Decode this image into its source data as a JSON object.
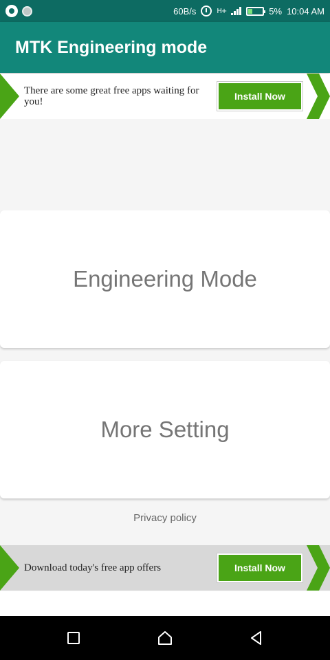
{
  "status_bar": {
    "speed": "60B/s",
    "data_label": "H+",
    "battery": "5%",
    "time": "10:04 AM",
    "icons": [
      "whatsapp-icon",
      "notification-dot-icon",
      "alarm-icon",
      "mobile-data-icon",
      "signal-icon",
      "battery-charging-icon"
    ]
  },
  "app_bar": {
    "title": "MTK Engineering mode"
  },
  "ad_top": {
    "text": "There are some great free apps waiting for you!",
    "button": "Install Now"
  },
  "cards": [
    {
      "label": "Engineering Mode"
    },
    {
      "label": "More Setting"
    }
  ],
  "privacy": "Privacy policy",
  "ad_bottom": {
    "text": "Download today's free app offers",
    "button": "Install Now"
  },
  "nav_bar": {
    "icons": [
      "recent-apps-icon",
      "home-icon",
      "back-icon"
    ]
  },
  "colors": {
    "status_bar": "#0d6b62",
    "app_bar": "#12877a",
    "ad_green": "#4aa416",
    "card_text": "#757575"
  }
}
